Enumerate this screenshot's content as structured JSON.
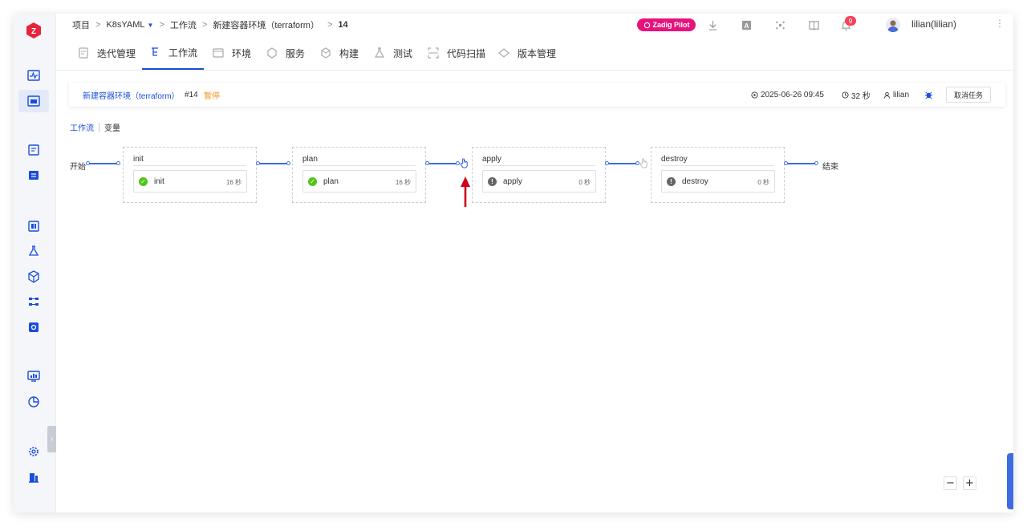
{
  "breadcrumb": {
    "project": "项目",
    "project_name": "K8sYAML",
    "workflow": "工作流",
    "workflow_name": "新建容器环境（terraform）",
    "run": "14"
  },
  "header": {
    "pilot_label": "Zadig Pilot",
    "notification_count": "9",
    "username": "lilian(lilian)"
  },
  "tabs": [
    {
      "label": "迭代管理",
      "icon": "iteration-icon"
    },
    {
      "label": "工作流",
      "icon": "workflow-icon"
    },
    {
      "label": "环境",
      "icon": "environment-icon"
    },
    {
      "label": "服务",
      "icon": "service-icon"
    },
    {
      "label": "构建",
      "icon": "build-icon"
    },
    {
      "label": "测试",
      "icon": "test-icon"
    },
    {
      "label": "代码扫描",
      "icon": "code-scan-icon"
    },
    {
      "label": "版本管理",
      "icon": "version-icon"
    }
  ],
  "task": {
    "name": "新建容器环境（terraform）",
    "number": "#14",
    "status": "暂停",
    "start_time": "2025-06-26 09:45",
    "duration": "32 秒",
    "user": "lilian",
    "cancel_label": "取消任务"
  },
  "subtabs": {
    "workflow": "工作流",
    "variables": "变量"
  },
  "pipeline": {
    "start_label": "开始",
    "end_label": "结束",
    "stages": [
      {
        "title": "init",
        "job": "init",
        "duration": "16 秒",
        "status": "success"
      },
      {
        "title": "plan",
        "job": "plan",
        "duration": "16 秒",
        "status": "success"
      },
      {
        "title": "apply",
        "job": "apply",
        "duration": "0 秒",
        "status": "paused"
      },
      {
        "title": "destroy",
        "job": "destroy",
        "duration": "0 秒",
        "status": "paused"
      }
    ]
  },
  "zoom": {
    "out": "−",
    "in": "+"
  },
  "colors": {
    "primary": "#1a4ddb",
    "success": "#52c41a",
    "paused": "#666666",
    "status_paused": "#f0921a",
    "pilot": "#e6137d",
    "arrow": "#d0021b"
  }
}
